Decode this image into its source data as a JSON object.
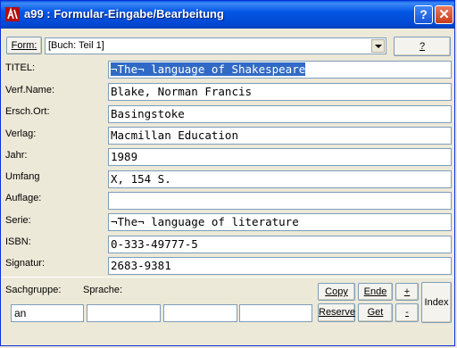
{
  "window": {
    "title": "a99 : Formular-Eingabe/Bearbeitung"
  },
  "toolbar": {
    "form_label": "Form:",
    "form_value": "[Buch: Teil 1]",
    "help_label": "?"
  },
  "fields": [
    {
      "label": "TITEL:",
      "value": "¬The¬ language of Shakespeare"
    },
    {
      "label": "Verf.Name:",
      "value": "Blake, Norman Francis"
    },
    {
      "label": "Ersch.Ort:",
      "value": "Basingstoke"
    },
    {
      "label": "Verlag:",
      "value": "Macmillan Education"
    },
    {
      "label": "Jahr:",
      "value": "1989"
    },
    {
      "label": "Umfang",
      "value": "X, 154 S."
    },
    {
      "label": "Auflage:",
      "value": ""
    },
    {
      "label": "Serie:",
      "value": "¬The¬ language of literature"
    },
    {
      "label": "ISBN:",
      "value": "0-333-49777-5"
    },
    {
      "label": "Signatur:",
      "value": "2683-9381"
    }
  ],
  "bottom": {
    "sachgruppe_label": "Sachgruppe:",
    "sprache_label": "Sprache:",
    "small_fields": [
      "an",
      "",
      "",
      ""
    ],
    "buttons": {
      "copy": "Copy",
      "ende": "Ende",
      "plus": "+",
      "reserve": "Reserve",
      "get": "Get",
      "minus": "-",
      "index": "Index"
    }
  }
}
